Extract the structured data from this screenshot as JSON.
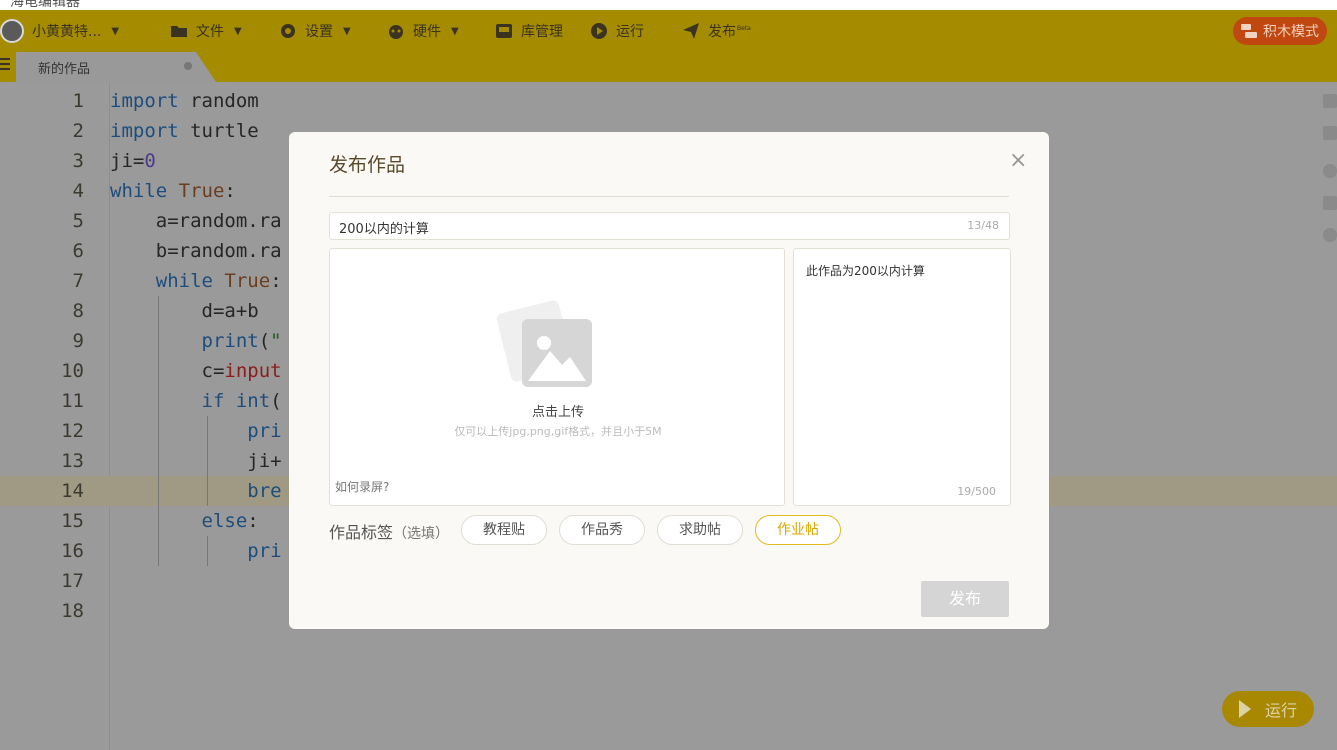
{
  "window_title": "海龟编辑器",
  "toolbar": {
    "user_name": "小黄黄特...",
    "file": "文件",
    "settings": "设置",
    "hardware": "硬件",
    "library": "库管理",
    "run": "运行",
    "publish": "发布",
    "publish_badge": "Beta",
    "blocks_mode": "积木模式"
  },
  "tab": {
    "label": "新的作品"
  },
  "code_lines": [
    {
      "n": "1",
      "text": "import random"
    },
    {
      "n": "2",
      "text": "import turtle"
    },
    {
      "n": "3",
      "text": "ji=0"
    },
    {
      "n": "4",
      "text": "while True:"
    },
    {
      "n": "5",
      "text": "    a=random.ra"
    },
    {
      "n": "6",
      "text": "    b=random.ra"
    },
    {
      "n": "7",
      "text": "    while True:"
    },
    {
      "n": "8",
      "text": "        d=a+b"
    },
    {
      "n": "9",
      "text": "        print(\""
    },
    {
      "n": "10",
      "text": "        c=input"
    },
    {
      "n": "11",
      "text": "        if int("
    },
    {
      "n": "12",
      "text": "            pri"
    },
    {
      "n": "13",
      "text": "            ji+"
    },
    {
      "n": "14",
      "text": "            bre"
    },
    {
      "n": "15",
      "text": "        else:"
    },
    {
      "n": "16",
      "text": "            pri"
    },
    {
      "n": "17",
      "text": ""
    },
    {
      "n": "18",
      "text": ""
    }
  ],
  "run_button": "运行",
  "modal": {
    "title": "发布作品",
    "close": "×",
    "name_value": "200以内的计算",
    "name_count": "13/48",
    "upload_title": "点击上传",
    "upload_hint": "仅可以上传jpg,png,gif格式，并且小于5M",
    "upload_help": "如何录屏?",
    "description": "此作品为200以内计算",
    "description_count": "19/500",
    "tags_label": "作品标签",
    "tags_optional": "（选填）",
    "tags": [
      "教程贴",
      "作品秀",
      "求助帖",
      "作业帖"
    ],
    "active_tag": "作业帖",
    "publish_button": "发布"
  },
  "colors": {
    "toolbar_bg": "#a48b00",
    "editor_bg": "#9a9a9a",
    "accent": "#e0bb20",
    "blocks_btn": "#c0470f"
  }
}
